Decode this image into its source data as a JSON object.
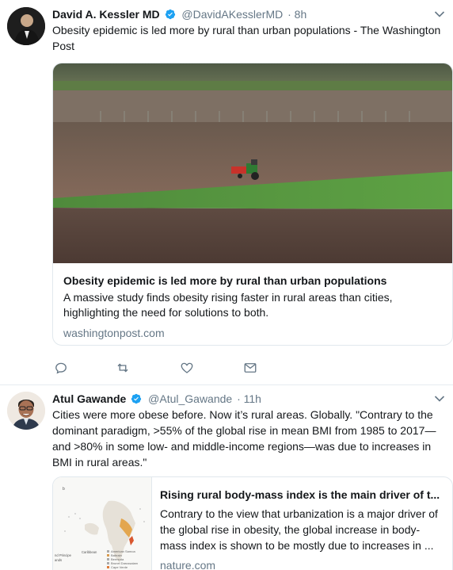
{
  "tweets": [
    {
      "author_name": "David A. Kessler MD",
      "author_handle": "@DavidAKesslerMD",
      "time": "· 8h",
      "text": "Obesity epidemic is led more by rural than urban populations - The Washington Post",
      "card": {
        "title": "Obesity epidemic is led more by rural than urban populations",
        "description": "A massive study finds obesity rising faster in rural areas than cities, highlighting the need for solutions to both.",
        "domain": "washingtonpost.com"
      }
    },
    {
      "author_name": "Atul Gawande",
      "author_handle": "@Atul_Gawande",
      "time": "· 11h",
      "text": "Cities were more obese before. Now it’s rural areas. Globally. \"Contrary to the dominant paradigm, >55% of the global rise in mean BMI from 1985 to 2017—and >80% in some low- and middle-income regions—was due to increases in BMI in rural areas.\"",
      "card": {
        "title": "Rising rural body-mass index is the main driver of t...",
        "description": "Contrary to the view that urbanization is a major driver of the global rise in obesity, the global increase in body-mass index is shown to be mostly due to increases in ...",
        "domain": "nature.com"
      }
    }
  ],
  "icons": {
    "verified": "verified-badge-icon",
    "caret": "chevron-down-icon",
    "reply": "reply-icon",
    "retweet": "retweet-icon",
    "like": "heart-icon",
    "dm": "envelope-icon"
  },
  "colors": {
    "verified": "#1da1f2",
    "secondary_text": "#657786",
    "border": "#e1e8ed"
  }
}
